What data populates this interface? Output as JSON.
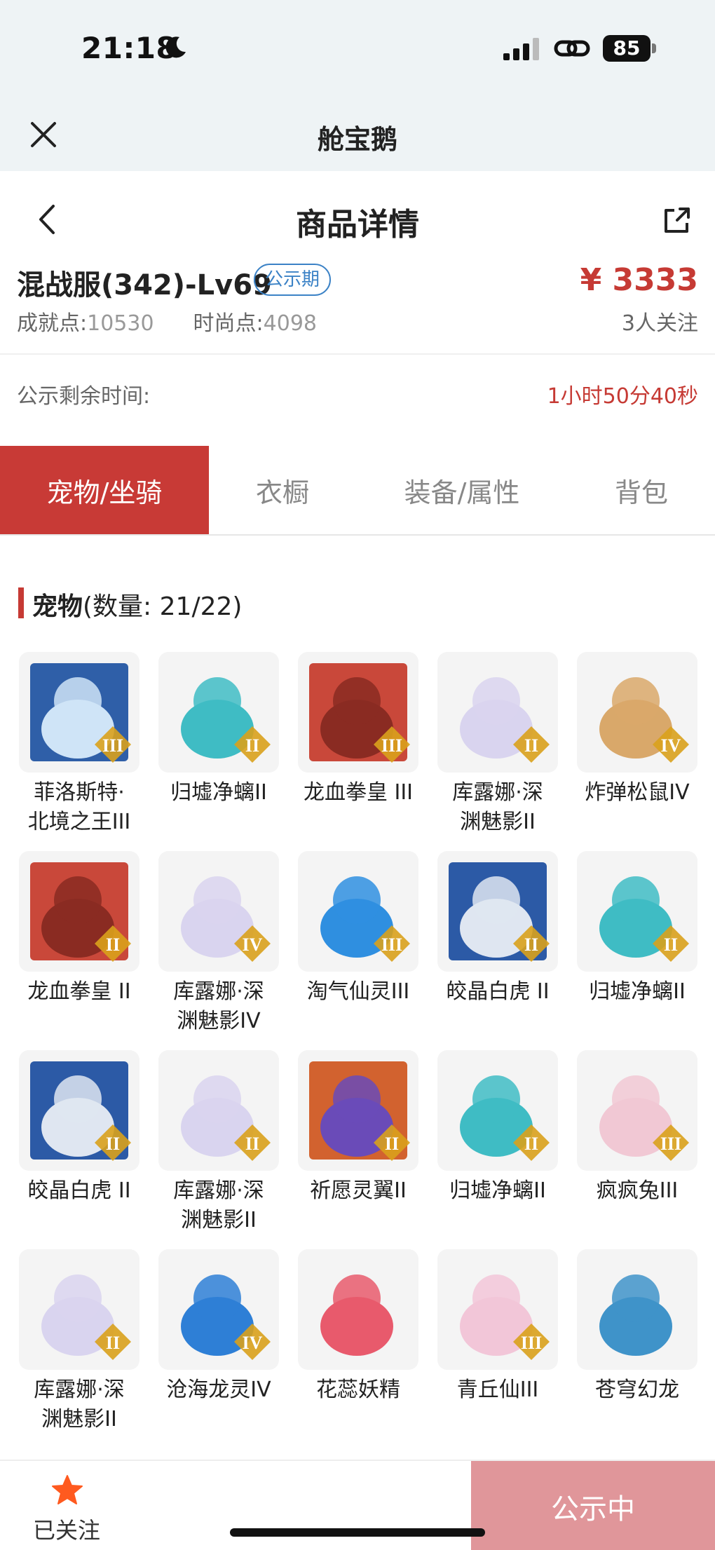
{
  "status_bar": {
    "time": "21:18",
    "battery": "85"
  },
  "mini_program": {
    "title": "舱宝鹅"
  },
  "header": {
    "title": "商品详情"
  },
  "product": {
    "name": "混战服(342)-Lv69",
    "badge": "公示期",
    "price": "¥ 3333",
    "achievement_label": "成就点:",
    "achievement_value": "10530",
    "fashion_label": "时尚点:",
    "fashion_value": "4098",
    "followers": "3人关注"
  },
  "countdown": {
    "label": "公示剩余时间:",
    "value": "1小时50分40秒"
  },
  "tabs": [
    {
      "label": "宠物/坐骑",
      "active": true
    },
    {
      "label": "衣橱",
      "active": false
    },
    {
      "label": "装备/属性",
      "active": false
    },
    {
      "label": "背包",
      "active": false
    }
  ],
  "section": {
    "title": "宠物",
    "count": "(数量: 21/22)"
  },
  "pets": [
    {
      "name": "菲洛斯特·\n北境之王III",
      "tier": "III",
      "icon": "frost-king-icon",
      "bg": "#2f5fa8",
      "fg": "#cfe4f7"
    },
    {
      "name": "归墟净螭II",
      "tier": "II",
      "icon": "jade-dragon-icon",
      "bg": "#f4f4f4",
      "fg": "#3fbcc4"
    },
    {
      "name": "龙血拳皇 III",
      "tier": "III",
      "icon": "ram-beast-icon",
      "bg": "#c9483a",
      "fg": "#8a2b22"
    },
    {
      "name": "库露娜·深\n渊魅影II",
      "tier": "II",
      "icon": "abyss-girl-icon",
      "bg": "#f4f4f4",
      "fg": "#d9d4ef"
    },
    {
      "name": "炸弹松鼠IV",
      "tier": "IV",
      "icon": "squirrel-icon",
      "bg": "#f4f4f4",
      "fg": "#d9a86a"
    },
    {
      "name": "龙血拳皇 II",
      "tier": "II",
      "icon": "ram-beast-icon",
      "bg": "#c9483a",
      "fg": "#8a2b22"
    },
    {
      "name": "库露娜·深\n渊魅影IV",
      "tier": "IV",
      "icon": "abyss-girl-icon",
      "bg": "#f4f4f4",
      "fg": "#d9d4ef"
    },
    {
      "name": "淘气仙灵III",
      "tier": "III",
      "icon": "blue-pup-icon",
      "bg": "#f4f4f4",
      "fg": "#2f8fe0"
    },
    {
      "name": "皎晶白虎 II",
      "tier": "II",
      "icon": "white-tiger-icon",
      "bg": "#2c5aa6",
      "fg": "#dfe6f1"
    },
    {
      "name": "归墟净螭II",
      "tier": "II",
      "icon": "jade-dragon-icon",
      "bg": "#f4f4f4",
      "fg": "#3fbcc4"
    },
    {
      "name": "皎晶白虎 II",
      "tier": "II",
      "icon": "white-tiger-icon",
      "bg": "#2c5aa6",
      "fg": "#dfe6f1"
    },
    {
      "name": "库露娜·深\n渊魅影II",
      "tier": "II",
      "icon": "abyss-girl-icon",
      "bg": "#f4f4f4",
      "fg": "#d9d4ef"
    },
    {
      "name": "祈愿灵翼II",
      "tier": "II",
      "icon": "fire-bird-icon",
      "bg": "#d2622f",
      "fg": "#6a4bb8"
    },
    {
      "name": "归墟净螭II",
      "tier": "II",
      "icon": "jade-dragon-icon",
      "bg": "#f4f4f4",
      "fg": "#3fbcc4"
    },
    {
      "name": "疯疯兔III",
      "tier": "III",
      "icon": "pink-rabbit-icon",
      "bg": "#f4f4f4",
      "fg": "#f1c8d4"
    },
    {
      "name": "库露娜·深\n渊魅影II",
      "tier": "II",
      "icon": "abyss-girl-icon",
      "bg": "#f4f4f4",
      "fg": "#d9d4ef"
    },
    {
      "name": "沧海龙灵IV",
      "tier": "IV",
      "icon": "sea-dragon-boy-icon",
      "bg": "#f4f4f4",
      "fg": "#2e7fd6"
    },
    {
      "name": "花蕊妖精",
      "tier": "",
      "icon": "flower-fairy-icon",
      "bg": "#f4f4f4",
      "fg": "#e85a6c"
    },
    {
      "name": "青丘仙III",
      "tier": "III",
      "icon": "fox-fairy-icon",
      "bg": "#f4f4f4",
      "fg": "#f2c6d8"
    },
    {
      "name": "苍穹幻龙",
      "tier": "",
      "icon": "sky-dragon-icon",
      "bg": "#f4f4f4",
      "fg": "#3f93c9"
    }
  ],
  "bottom": {
    "follow_label": "已关注",
    "status_button": "公示中"
  },
  "colors": {
    "accent": "#c83a36",
    "badge_blue": "#3b82c6",
    "status_button": "#e0969a",
    "tier_badge": "#d9a11c"
  }
}
